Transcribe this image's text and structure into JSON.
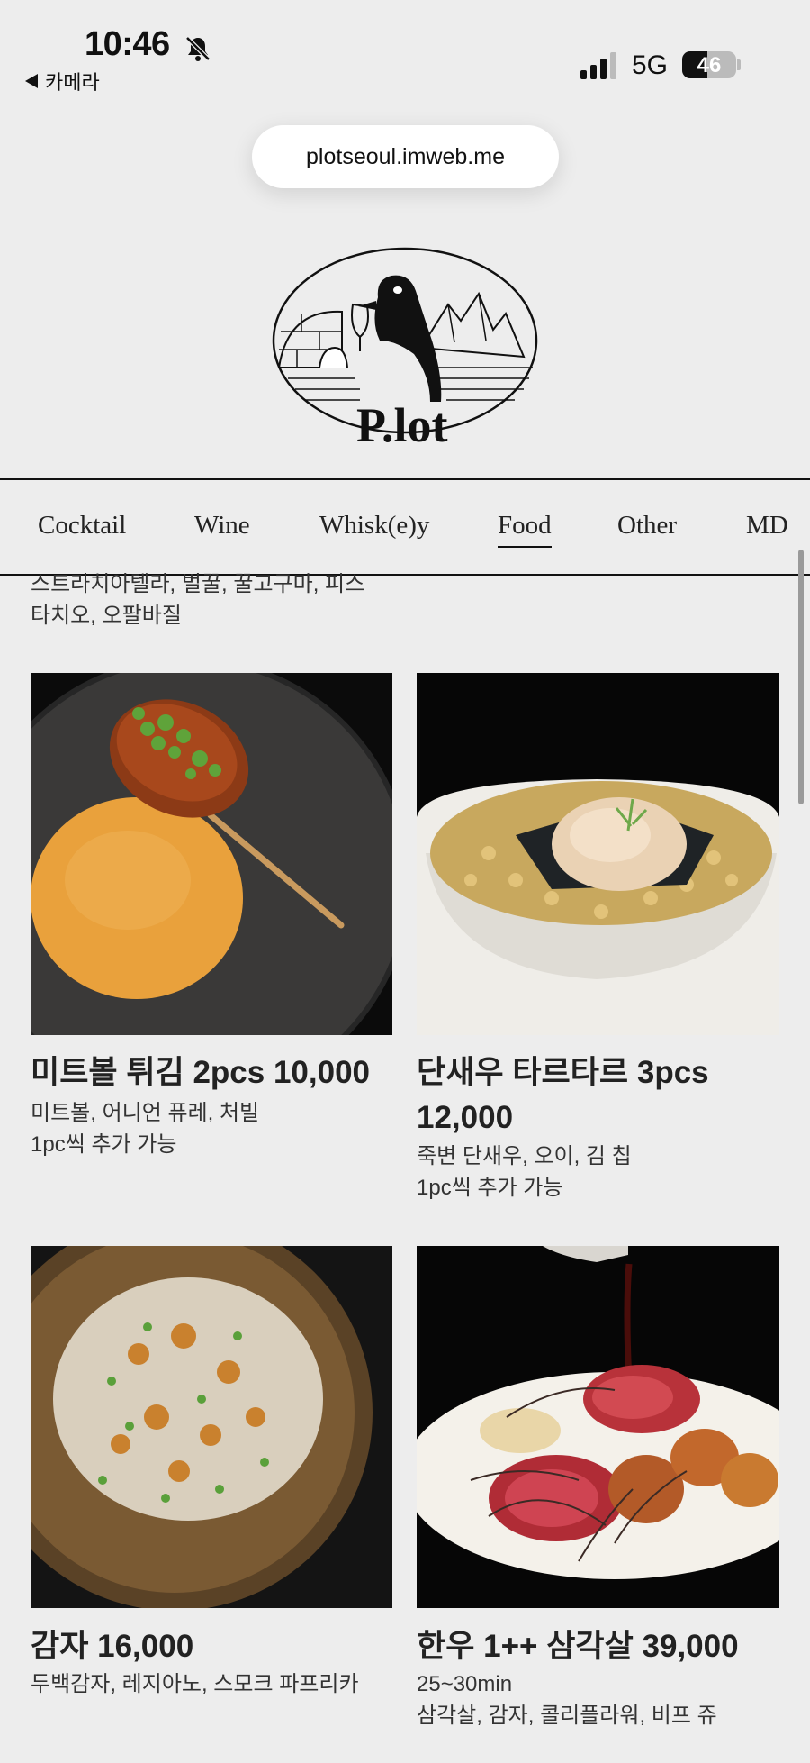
{
  "status_bar": {
    "time": "10:46",
    "back_label": "카메라",
    "network": "5G",
    "battery": "46",
    "battery_level": 0.46
  },
  "browser": {
    "url": "plotseoul.imweb.me"
  },
  "logo": {
    "alt": "P.lot"
  },
  "nav": {
    "tabs": [
      {
        "label": "Cocktail"
      },
      {
        "label": "Wine"
      },
      {
        "label": "Whisk(e)y"
      },
      {
        "label": "Food",
        "active": true
      },
      {
        "label": "Other"
      },
      {
        "label": "MD"
      }
    ]
  },
  "prev_item": {
    "desc_line1": "스트라치아텔라, 벌꿀, 꿀고구마, 피스",
    "desc_line2": "타치오, 오팔바질"
  },
  "items": [
    {
      "title": "미트볼 튀김 2pcs 10,000",
      "lines": [
        "미트볼, 어니언 퓨레, 처빌",
        "1pc씩 추가 가능"
      ]
    },
    {
      "title_line1": "단새우 타르타르 3pcs",
      "title_line2": "12,000",
      "lines": [
        "죽변 단새우, 오이, 김 칩",
        "1pc씩 추가 가능"
      ]
    },
    {
      "title": "감자 16,000",
      "lines": [
        "두백감자, 레지아노, 스모크 파프리카"
      ]
    },
    {
      "title": "한우 1++ 삼각살 39,000",
      "lines": [
        "25~30min",
        "삼각살, 감자, 콜리플라워, 비프 쥬"
      ]
    }
  ],
  "colors": {
    "background": "#ededed",
    "text": "#222222",
    "photo_background": "#0b0b0b"
  }
}
